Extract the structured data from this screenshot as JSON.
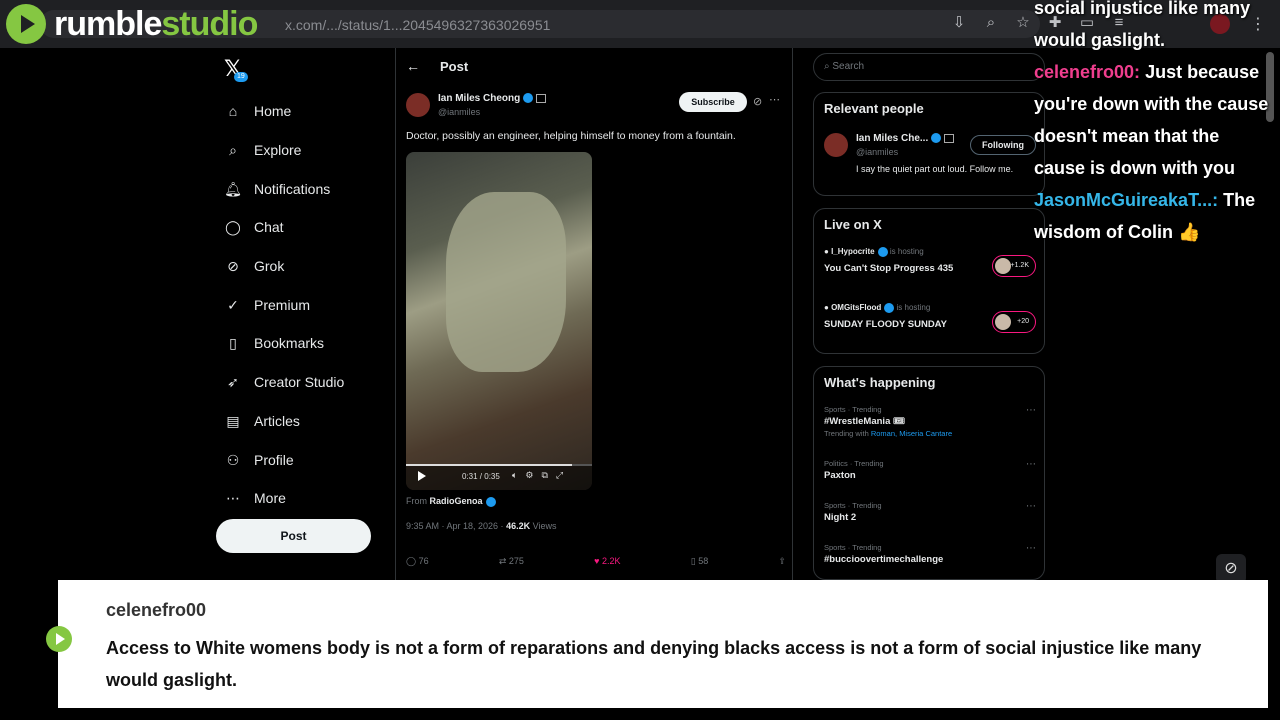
{
  "browser": {
    "url": "x.com/.../status/1...2045496327363026951",
    "icons": [
      "install-icon",
      "zoom-icon",
      "star-icon",
      "extensions-icon",
      "split-icon",
      "tab-icon"
    ]
  },
  "rumble": {
    "brand": "rumble",
    "studio": "studio"
  },
  "nav": {
    "logo": "𝕏",
    "items": [
      {
        "label": "Home",
        "icon": "home-icon",
        "glyph": "⌂"
      },
      {
        "label": "Explore",
        "icon": "search-icon",
        "glyph": "⌕"
      },
      {
        "label": "Notifications",
        "icon": "bell-icon",
        "glyph": "🔔︎",
        "badge": "19"
      },
      {
        "label": "Chat",
        "icon": "chat-icon",
        "glyph": "◯"
      },
      {
        "label": "Grok",
        "icon": "grok-icon",
        "glyph": "⊘"
      },
      {
        "label": "Premium",
        "icon": "premium-icon",
        "glyph": "✓"
      },
      {
        "label": "Bookmarks",
        "icon": "bookmark-icon",
        "glyph": "▯"
      },
      {
        "label": "Creator Studio",
        "icon": "rocket-icon",
        "glyph": "➶"
      },
      {
        "label": "Articles",
        "icon": "articles-icon",
        "glyph": "▤"
      },
      {
        "label": "Profile",
        "icon": "profile-icon",
        "glyph": "⚇"
      },
      {
        "label": "More",
        "icon": "more-icon",
        "glyph": "⋯"
      }
    ],
    "post_button": "Post"
  },
  "post": {
    "header": "Post",
    "author": "Ian Miles Cheong",
    "handle": "@ianmiles",
    "subscribe": "Subscribe",
    "text": "Doctor, possibly an engineer, helping himself to money from a fountain.",
    "video_time": "0:31 / 0:35",
    "video_progress": 0.89,
    "from_label": "From",
    "from_account": "RadioGenoa",
    "timestamp": "9:35 AM · Apr 18, 2026 ·",
    "views_count": "46.2K",
    "views_label": "Views",
    "actions": {
      "replies": "76",
      "reposts": "275",
      "likes": "2.2K",
      "bookmarks": "58"
    }
  },
  "sidebar": {
    "search_placeholder": "Search",
    "relevant": {
      "title": "Relevant people",
      "name": "Ian Miles Che...",
      "handle": "@ianmiles",
      "follow_label": "Following",
      "bio": "I say the quiet part out loud. Follow me."
    },
    "live": {
      "title": "Live on X",
      "items": [
        {
          "host": "I_Hypocrite",
          "status": "is hosting",
          "title": "You Can't Stop Progress 435",
          "count": "+1.2K"
        },
        {
          "host": "OMGitsFlood",
          "status": "is hosting",
          "title": "SUNDAY FLOODY SUNDAY",
          "count": "+20"
        }
      ]
    },
    "happening": {
      "title": "What's happening",
      "trends": [
        {
          "category": "Sports · Trending",
          "name": "#WrestleMania 🎟",
          "with_label": "Trending with",
          "with": "Roman, Miseria Cantare"
        },
        {
          "category": "Politics · Trending",
          "name": "Paxton",
          "with_label": "",
          "with": ""
        },
        {
          "category": "Sports · Trending",
          "name": "Night 2",
          "with_label": "",
          "with": ""
        },
        {
          "category": "Sports · Trending",
          "name": "#buccioovertimechallenge",
          "with_label": "",
          "with": ""
        }
      ]
    }
  },
  "chat_overlay": {
    "line0": "social injustice like many would gaslight.",
    "msg1_user": "celenefro00:",
    "msg1_text": "Just because you're down with the cause doesn't mean that the cause is down with you",
    "msg2_user": "JasonMcGuireakaT...:",
    "msg2_text": "The wisdom of Colin 👍"
  },
  "banner": {
    "user": "celenefro00",
    "message": "Access to White womens body is not a form of reparations and denying blacks access is not a form of social injustice like many would gaslight."
  },
  "colors": {
    "rumble_green": "#85c742",
    "x_blue": "#1d9bf0",
    "like_pink": "#f91880",
    "chat_pink": "#ef3e8e",
    "chat_blue": "#35b6e8"
  }
}
